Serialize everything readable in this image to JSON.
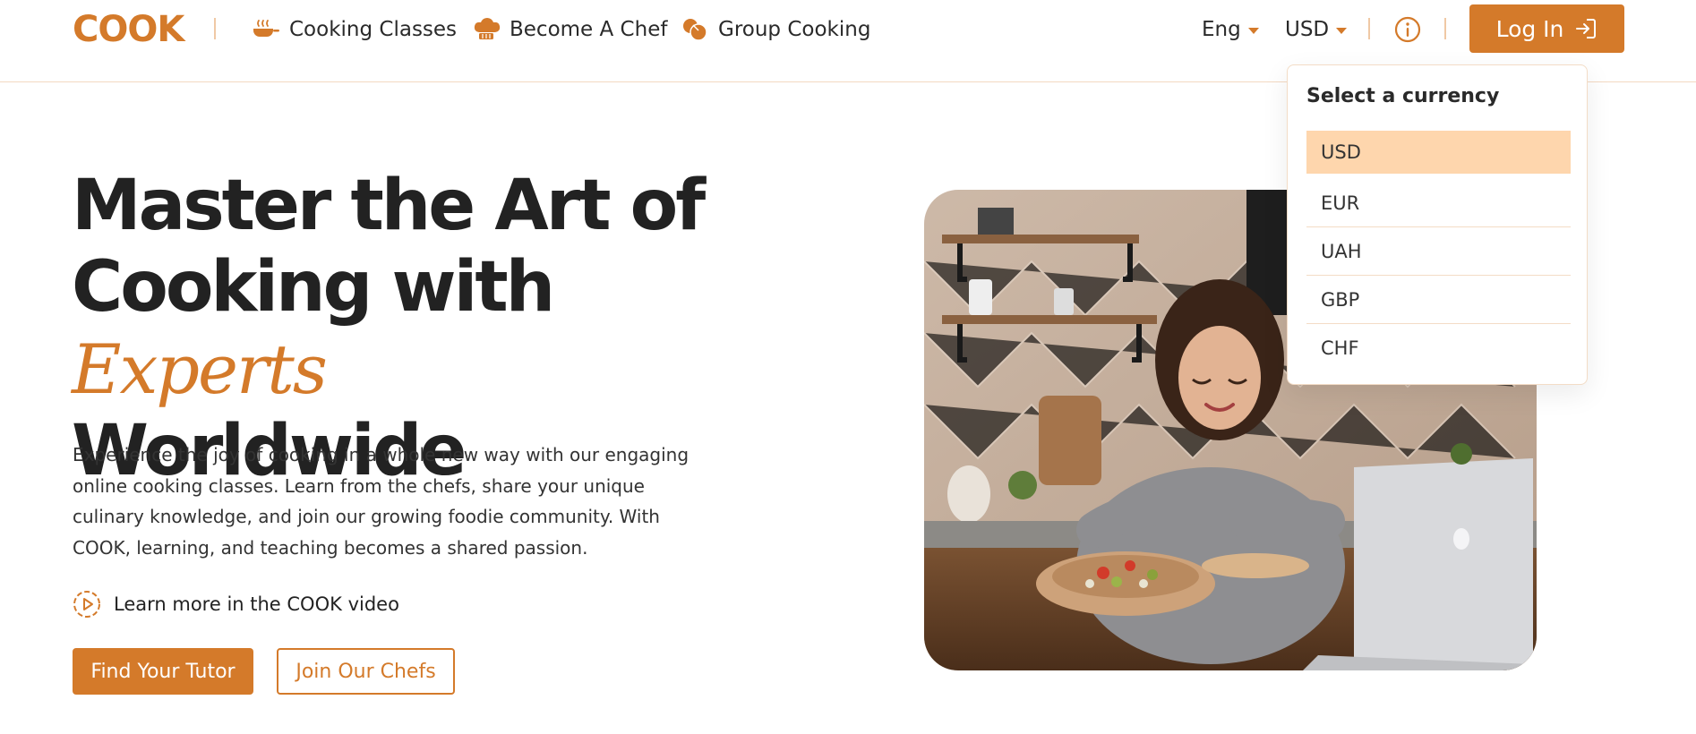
{
  "header": {
    "logo": "COOK",
    "nav": [
      {
        "label": "Cooking Classes",
        "icon": "pan-icon"
      },
      {
        "label": "Become A Chef",
        "icon": "chef-hat-icon"
      },
      {
        "label": "Group Cooking",
        "icon": "ingredients-icon"
      }
    ],
    "language": "Eng",
    "currency": "USD",
    "login_label": "Log In"
  },
  "hero": {
    "headline_line1": "Master the Art of",
    "headline_line2_start": "Cooking with",
    "headline_accent": "Experts",
    "headline_line3": "Worldwide",
    "description": "Experience the joy of cooking in a whole new way with our engaging online cooking classes. Learn from the chefs, share your unique culinary knowledge, and join our growing foodie community. With COOK, learning, and teaching becomes a shared passion.",
    "video_link": "Learn more in the COOK video",
    "primary_button": "Find Your Tutor",
    "secondary_button": "Join Our Chefs"
  },
  "currency_dropdown": {
    "title": "Select a currency",
    "options": [
      "USD",
      "EUR",
      "UAH",
      "GBP",
      "CHF"
    ],
    "selected": "USD"
  },
  "colors": {
    "accent": "#d47a2a",
    "selected_bg": "#fed6ad",
    "text": "#222222"
  }
}
